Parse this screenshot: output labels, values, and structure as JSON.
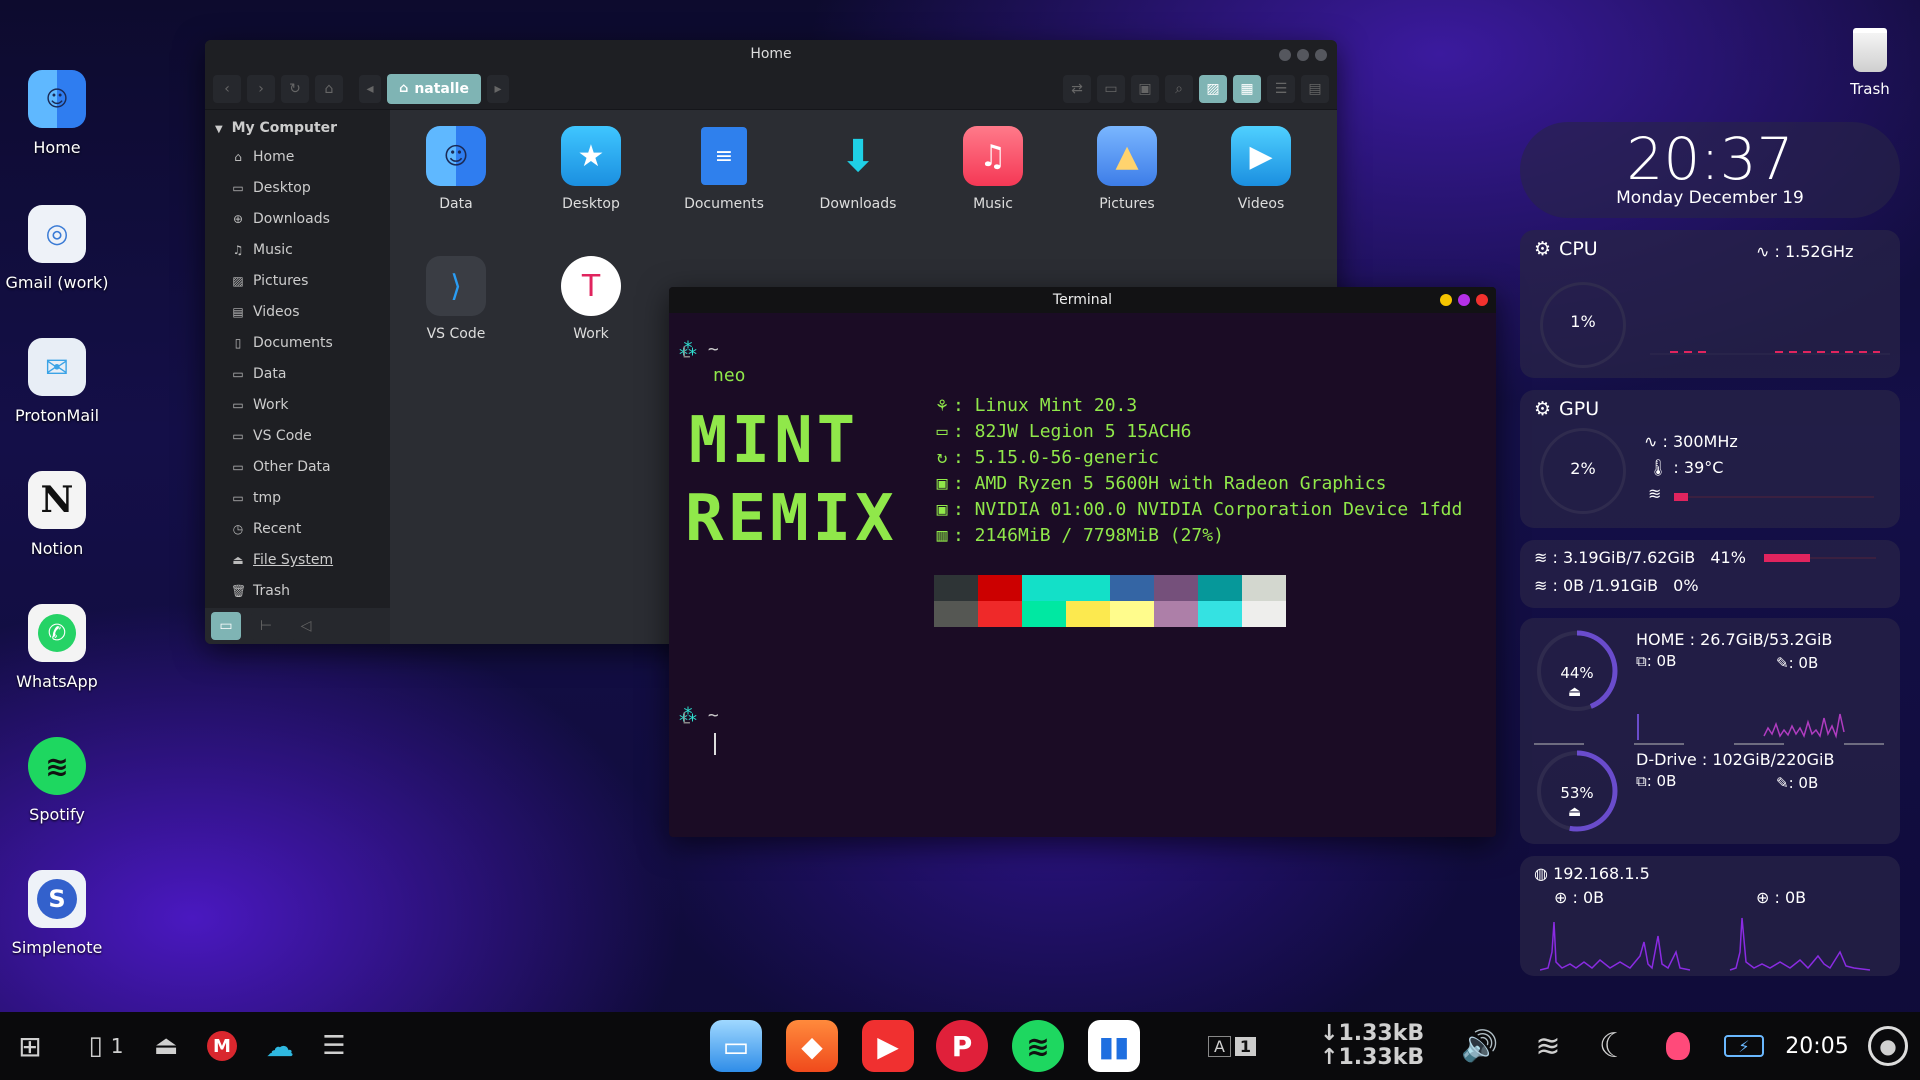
{
  "desktop_icons": [
    {
      "label": "Home",
      "icon": "finder-face-icon"
    },
    {
      "label": "Gmail (work)",
      "icon": "gmail-icon"
    },
    {
      "label": "ProtonMail",
      "icon": "protonmail-icon"
    },
    {
      "label": "Notion",
      "icon": "notion-icon"
    },
    {
      "label": "WhatsApp",
      "icon": "whatsapp-icon"
    },
    {
      "label": "Spotify",
      "icon": "spotify-icon"
    },
    {
      "label": "Simplenote",
      "icon": "simplenote-icon"
    }
  ],
  "trash_desktop": {
    "label": "Trash"
  },
  "file_manager": {
    "title": "Home",
    "breadcrumb": "natalle",
    "sidebar_header": "My Computer",
    "sidebar_items": [
      "Home",
      "Desktop",
      "Downloads",
      "Music",
      "Pictures",
      "Videos",
      "Documents",
      "Data",
      "Work",
      "VS Code",
      "Other Data",
      "tmp",
      "Recent",
      "File System",
      "Trash"
    ],
    "items": [
      "Data",
      "Desktop",
      "Documents",
      "Downloads",
      "Music",
      "Pictures",
      "Videos",
      "VS Code",
      "Work"
    ]
  },
  "terminal": {
    "title": "Terminal",
    "prompt_symbol": "~",
    "command": "neo",
    "logo_line1": "MINT",
    "logo_line2": "REMIX",
    "info": [
      ": Linux Mint 20.3",
      ": 82JW Legion 5 15ACH6",
      ": 5.15.0-56-generic",
      ": AMD Ryzen 5 5600H with Radeon Graphics",
      ": NVIDIA 01:00.0 NVIDIA Corporation Device 1fdd",
      ": 2146MiB / 7798MiB (27%)"
    ],
    "palette_top": [
      "#2e3436",
      "#cc0000",
      "#13e0c8",
      "#13e0c8",
      "#3465a4",
      "#75507b",
      "#06989a",
      "#d3d7cf"
    ],
    "palette_bottom": [
      "#555753",
      "#ef2929",
      "#00e8a2",
      "#fce94f",
      "#fffc8c",
      "#ad7fa8",
      "#34e2e2",
      "#eeeeec"
    ]
  },
  "clock": {
    "time": "20:37",
    "date": "Monday December 19"
  },
  "cpu": {
    "title": "CPU",
    "freq": ": 1.52GHz",
    "usage": "1%"
  },
  "gpu": {
    "title": "GPU",
    "freq": ": 300MHz",
    "temp": ": 39°C",
    "usage": "2%"
  },
  "memory": {
    "ram": ": 3.19GiB/7.62GiB",
    "ram_pct": "41%",
    "ram_level": 0.41,
    "swap": ": 0B /1.91GiB",
    "swap_pct": "0%"
  },
  "disks": [
    {
      "name": "HOME : 26.7GiB/53.2GiB",
      "read": ": 0B",
      "write": ": 0B",
      "pct": "44%",
      "level": 0.44
    },
    {
      "name": "D-Drive : 102GiB/220GiB",
      "read": ": 0B",
      "write": ": 0B",
      "pct": "53%",
      "level": 0.53
    }
  ],
  "network": {
    "ip": "192.168.1.5",
    "up": ": 0B",
    "down": ": 0B"
  },
  "taskbar": {
    "workspace_count": "1",
    "kb_layout": "A",
    "kb_num": "1",
    "net_down": "1.33kB",
    "net_up": "1.33kB",
    "time": "20:05"
  },
  "colors": {
    "accent_teal": "#7fb4b4",
    "terminal_green": "#90e84a",
    "widget_pink": "#e0245e",
    "widget_purple": "#6a4ccc"
  }
}
